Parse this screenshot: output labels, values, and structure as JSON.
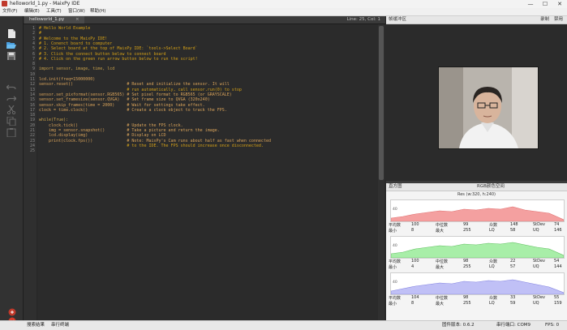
{
  "window": {
    "title": "helloworld_1.py - MaixPy IDE",
    "controls": {
      "minimize": "—",
      "maximize": "☐",
      "close": "✕"
    }
  },
  "menu": [
    "文件(F)",
    "编辑(E)",
    "工具(T)",
    "窗口(W)",
    "帮助(H)"
  ],
  "editor": {
    "tab_label": "helloworld_1.py",
    "tab_close": "×",
    "line_col": "Line: 25, Col: 1",
    "line_numbers": [
      "1",
      "2",
      "3",
      "4",
      "5",
      "6",
      "7",
      "8",
      "9",
      "10",
      "11",
      "12",
      "13",
      "14",
      "15",
      "16",
      "17",
      "18",
      "19",
      "20",
      "21",
      "22",
      "23",
      "24",
      "25"
    ],
    "code_lines": [
      "# Hello World Example",
      "#",
      "# Welcome to the MaixPy IDE!",
      "# 1. Conenct board to computer",
      "# 2. Select board at the top of MaixPy IDE: `tools->Select Board`",
      "# 3. Click the connect button below to connect board",
      "# 4. Click on the green run arrow button below to run the script!",
      "",
      "import sensor, image, time, lcd",
      "",
      "lcd.init(freq=15000000)",
      "sensor.reset()                      # Reset and initialize the sensor. It will",
      "                                    # run automatically, call sensor.run(0) to stop",
      "sensor.set_pixformat(sensor.RGB565) # Set pixel format to RGB565 (or GRAYSCALE)",
      "sensor.set_framesize(sensor.QVGA)   # Set frame size to QVGA (320x240)",
      "sensor.skip_frames(time = 2000)     # Wait for settings take effect.",
      "clock = time.clock()                # Create a clock object to track the FPS.",
      "",
      "while(True):",
      "    clock.tick()                    # Update the FPS clock.",
      "    img = sensor.snapshot()         # Take a picture and return the image.",
      "    lcd.display(img)                # Display on LCD",
      "    print(clock.fps())              # Note: MaixPy's Cam runs about half as fast when connected",
      "                                    # to the IDE. The FPS should increase once disconnected.",
      ""
    ]
  },
  "frame_buffer": {
    "title": "帧缓冲区",
    "controls": [
      "录制",
      "禁用"
    ]
  },
  "histogram": {
    "tabs": [
      "直方图",
      "RGB颜色空间"
    ],
    "resolution": "Res (w:320, h:240)",
    "channels": [
      {
        "color": "#f08080",
        "axis_min": "0",
        "axis_max": "255",
        "axis_mid": "40",
        "stats_row1": [
          "平均数",
          "100",
          "中位数",
          "99",
          "众数",
          "148",
          "StDev",
          "74"
        ],
        "stats_row2": [
          "最小",
          "8",
          "最大",
          "255",
          "LQ",
          "58",
          "UQ",
          "146"
        ]
      },
      {
        "color": "#90e090",
        "axis_min": "0",
        "axis_max": "255",
        "axis_mid": "40",
        "stats_row1": [
          "平均数",
          "100",
          "中位数",
          "98",
          "众数",
          "22",
          "StDev",
          "54"
        ],
        "stats_row2": [
          "最小",
          "4",
          "最大",
          "255",
          "LQ",
          "57",
          "UQ",
          "144"
        ]
      },
      {
        "color": "#a0a0f0",
        "axis_min": "0",
        "axis_max": "255",
        "axis_mid": "40",
        "stats_row1": [
          "平均数",
          "104",
          "中位数",
          "98",
          "众数",
          "33",
          "StDev",
          "55"
        ],
        "stats_row2": [
          "最小",
          "8",
          "最大",
          "255",
          "LQ",
          "59",
          "UQ",
          "159"
        ]
      }
    ]
  },
  "status": {
    "search_results": "搜索结果",
    "serial_terminal": "串行终端",
    "firmware": "固件版本: 0.6.2",
    "serial_port": "串行端口: COM9",
    "fps": "FPS: 0"
  },
  "toolbar_icons": [
    "new-file-icon",
    "open-file-icon",
    "save-file-icon",
    "undo-icon",
    "redo-icon",
    "cut-icon",
    "copy-icon",
    "paste-icon",
    "connect-icon",
    "run-icon"
  ]
}
